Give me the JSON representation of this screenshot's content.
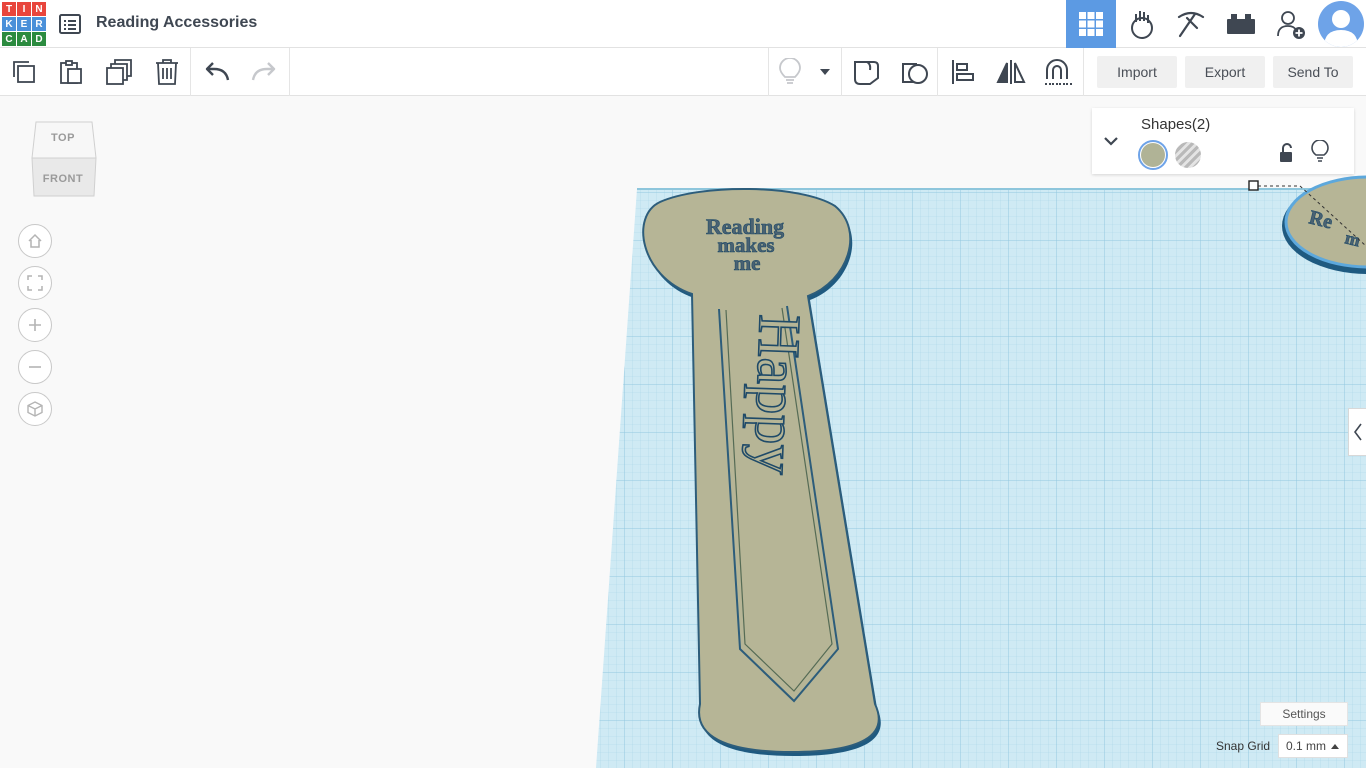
{
  "app": {
    "logo_letters": [
      "T",
      "I",
      "N",
      "K",
      "E",
      "R",
      "C",
      "A",
      "D"
    ],
    "logo_colors": [
      "#e8453c",
      "#e8453c",
      "#e8453c",
      "#4a90d9",
      "#4a90d9",
      "#4a90d9",
      "#2b8b3f",
      "#2b8b3f",
      "#2b8b3f"
    ],
    "design_title": "Reading Accessories",
    "accent_color": "#5c9ae3"
  },
  "top_icons": [
    "3d-design-grid-icon",
    "codeblocks-icon",
    "bricks-pickaxe-icon",
    "lego-brick-icon",
    "add-user-icon",
    "avatar"
  ],
  "toolbar": {
    "tools": [
      "copy-icon",
      "paste-icon",
      "duplicate-icon",
      "delete-icon",
      "undo-icon",
      "redo-icon",
      "lightbulb-icon",
      "dropdown-icon",
      "note-icon",
      "workplane-icon",
      "align-icon",
      "mirror-icon",
      "magnet-group-icon"
    ],
    "import_label": "Import",
    "export_label": "Export",
    "send_to_label": "Send To"
  },
  "view_cube": {
    "top_label": "TOP",
    "front_label": "FRONT"
  },
  "nav_controls": [
    "home-icon",
    "fit-view-icon",
    "zoom-in-icon",
    "zoom-out-icon",
    "perspective-icon"
  ],
  "shapes_panel": {
    "title": "Shapes(2)",
    "solid_color": "#b0b396"
  },
  "workplane_text": {
    "bookmark_head": [
      "Reading",
      "makes",
      "me"
    ],
    "bookmark_body": "Happy",
    "second_shape_text": [
      "Re",
      "m"
    ]
  },
  "footer": {
    "settings_label": "Settings",
    "snap_grid_label": "Snap Grid",
    "snap_grid_value": "0.1 mm"
  }
}
